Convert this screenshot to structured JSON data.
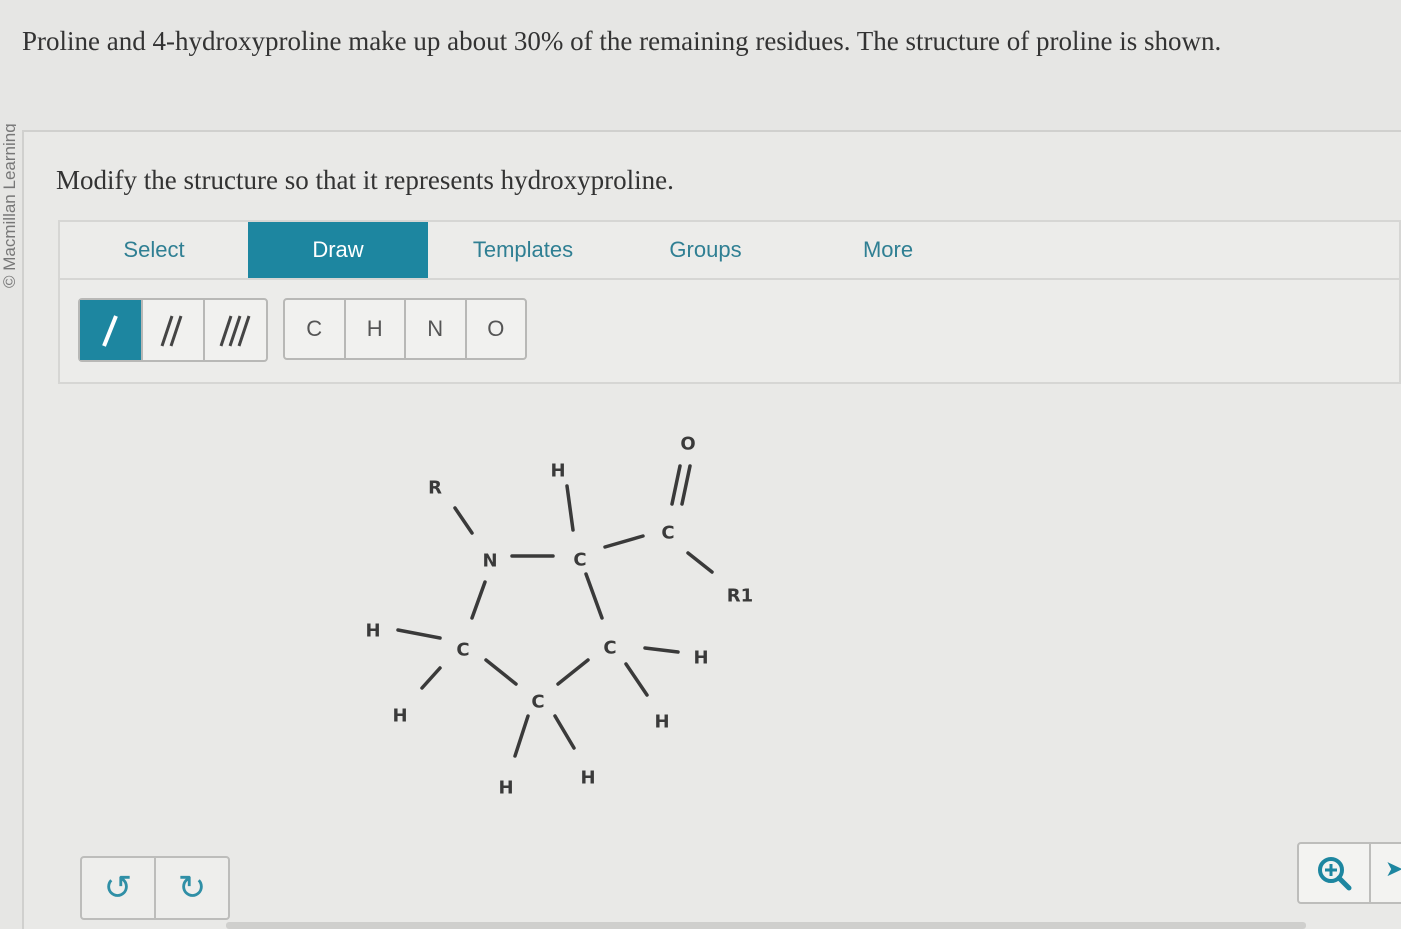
{
  "side_text": "© Macmillan Learning",
  "intro_text": "Proline and 4-hydroxyproline make up about 30% of the remaining residues. The structure of proline is shown.",
  "question_text": "Modify the structure so that it represents hydroxyproline.",
  "tabs": [
    {
      "label": "Select",
      "active": false
    },
    {
      "label": "Draw",
      "active": true
    },
    {
      "label": "Templates",
      "active": false
    },
    {
      "label": "Groups",
      "active": false
    },
    {
      "label": "More",
      "active": false
    }
  ],
  "bond_tools": [
    {
      "name": "single-bond",
      "glyph": "/",
      "active": true
    },
    {
      "name": "double-bond",
      "glyph": "//",
      "active": false
    },
    {
      "name": "triple-bond",
      "glyph": "///",
      "active": false
    }
  ],
  "atom_tools": [
    "C",
    "H",
    "N",
    "O"
  ],
  "molecule": {
    "atoms": [
      {
        "label": "O"
      },
      {
        "label": "H"
      },
      {
        "label": "R"
      },
      {
        "label": "C"
      },
      {
        "label": "N"
      },
      {
        "label": "C"
      },
      {
        "label": "R1"
      },
      {
        "label": "H"
      },
      {
        "label": "C"
      },
      {
        "label": "C"
      },
      {
        "label": "H"
      },
      {
        "label": "H"
      },
      {
        "label": "C"
      },
      {
        "label": "H"
      },
      {
        "label": "H"
      },
      {
        "label": "H"
      }
    ]
  },
  "history_tools": [
    {
      "name": "undo",
      "glyph": "↺"
    },
    {
      "name": "redo",
      "glyph": "↻"
    }
  ],
  "colors": {
    "accent": "#1d86a0",
    "text": "#333333",
    "background": "#e6e6e4"
  }
}
